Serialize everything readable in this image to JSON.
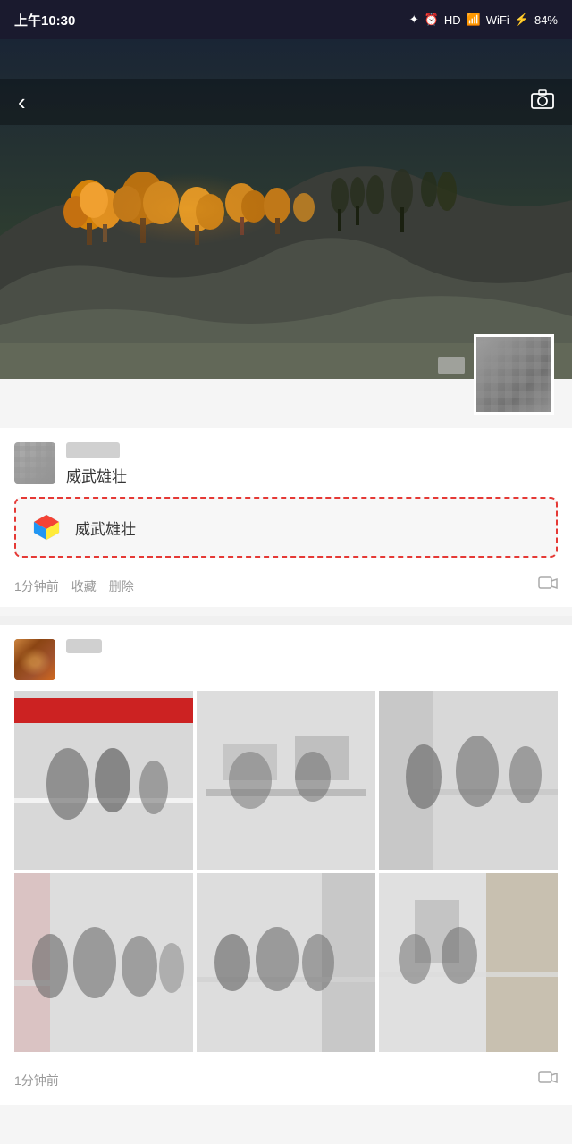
{
  "statusBar": {
    "time": "上午10:30",
    "battery": "84%",
    "icons": [
      "bluetooth",
      "clock",
      "hd",
      "signal1",
      "signal2",
      "wifi",
      "charging"
    ]
  },
  "header": {
    "backLabel": "‹",
    "cameraLabel": "⊙"
  },
  "post1": {
    "username": "威武雄壮",
    "highlightedText": "威武雄壮",
    "timeAgo": "1分钟前",
    "favoriteLabel": "收藏",
    "deleteLabel": "删除"
  },
  "post2": {
    "timeAgo": "1分钟前"
  }
}
